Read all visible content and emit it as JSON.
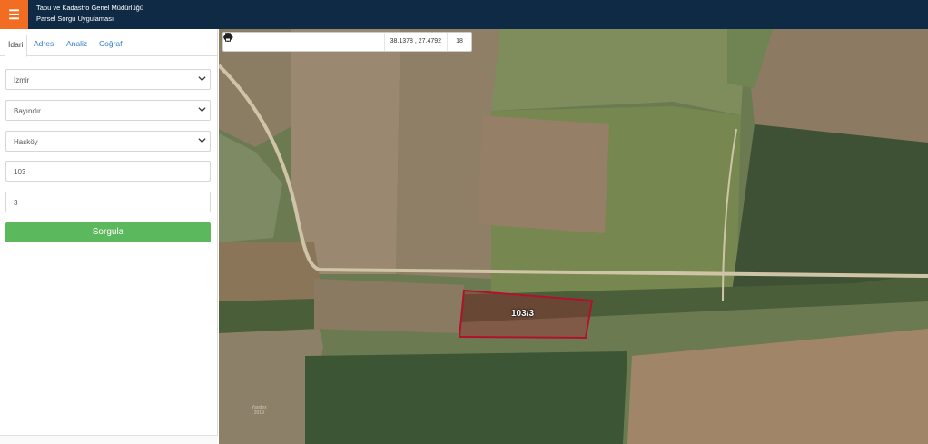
{
  "header": {
    "menu_icon": "hamburger-icon",
    "title_line1": "Tapu ve Kadastro Genel Müdürlüğü",
    "title_line2": "Parsel Sorgu Uygulaması",
    "background": "#0e2a44",
    "accent": "#f26d21"
  },
  "sidebar": {
    "tabs": [
      {
        "label": "İdari",
        "active": true
      },
      {
        "label": "Adres",
        "active": false
      },
      {
        "label": "Analiz",
        "active": false
      },
      {
        "label": "Coğrafi",
        "active": false
      }
    ],
    "province_select": "İzmir",
    "district_select": "Bayındır",
    "neighborhood_select": "Hasköy",
    "block_input": "103",
    "parcel_input": "3",
    "query_button": "Sorgula",
    "query_button_color": "#5cb85c"
  },
  "map": {
    "toolbar": {
      "tools": [
        "zoom-in-icon",
        "zoom-out-icon",
        "refresh-icon",
        "locate-icon",
        "info-icon",
        "favorite-icon",
        "measure-icon",
        "print-icon"
      ],
      "coordinates": "38.1378 , 27.4792",
      "zoom_level": "18"
    },
    "parcel_label": "103/3",
    "parcel_outline_color": "#b0122d",
    "watermark_line1": "Yandex",
    "watermark_line2": "2019"
  }
}
